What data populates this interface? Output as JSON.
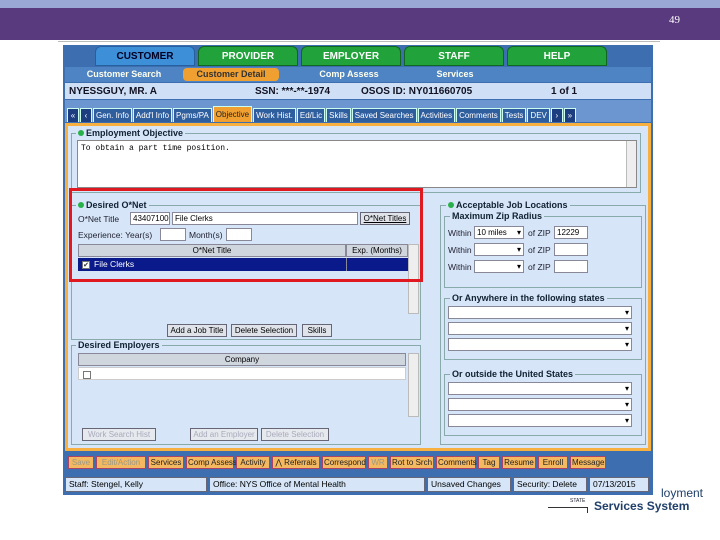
{
  "slide": {
    "page_number": "49"
  },
  "main_tabs": [
    "CUSTOMER",
    "PROVIDER",
    "EMPLOYER",
    "STAFF",
    "HELP"
  ],
  "sub_nav": [
    "Customer Search",
    "Customer Detail",
    "Comp Assess",
    "Services"
  ],
  "customer": {
    "name": "NYESSGUY, MR. A",
    "ssn": "SSN: ***-**-1974",
    "osos_id": "OSOS ID: NY011660705",
    "page": "1 of 1"
  },
  "detail_tabs": [
    "Gen. Info",
    "Add'l Info",
    "Pgms/PA",
    "Objective",
    "Work Hist.",
    "Ed/Lic",
    "Skills",
    "Saved Searches",
    "Activities",
    "Comments",
    "Tests",
    "DEV"
  ],
  "employment_objective": {
    "legend": "Employment Objective",
    "text": "To obtain a part time position."
  },
  "desired_onet": {
    "legend": "Desired O*Net",
    "onet_title_label": "O*Net Title",
    "code": "43407100",
    "title": "File Clerks",
    "onet_titles_button": "O*Net Titles",
    "experience_label": "Experience: Year(s)",
    "months_label": "Month(s)",
    "col_title": "O*Net Title",
    "col_exp": "Exp. (Months)",
    "row_title": "File Clerks",
    "row_checked": "✔"
  },
  "job_buttons": [
    "Add a Job Title",
    "Delete Selection",
    "Skills"
  ],
  "desired_employers": {
    "legend": "Desired Employers",
    "col_company": "Company",
    "buttons": [
      "Work Search Hist",
      "Add an Employer",
      "Delete Selection"
    ]
  },
  "acceptable": {
    "legend": "Acceptable Job Locations",
    "radius_legend": "Maximum Zip Radius",
    "within": "Within",
    "of_zip": "of ZIP",
    "miles": "10 miles",
    "zip": "12229",
    "anywhere_legend": "Or Anywhere in the following states",
    "outside_legend": "Or outside the United States"
  },
  "bottom_buttons": [
    "Save",
    "Edit/Action",
    "Services",
    "Comp Assess",
    "Activity",
    "Referrals",
    "Correspond",
    "WR",
    "Rot to Srch",
    "Comments",
    "Tag",
    "Resume",
    "Enroll",
    "Message"
  ],
  "status": {
    "staff": "Staff: Stengel, Kelly",
    "office": "Office: NYS Office of Mental Health",
    "unsaved": "Unsaved Changes",
    "security": "Security: Delete",
    "date": "07/13/2015"
  },
  "logo": {
    "line1": "loyment",
    "line2_state": "STATE",
    "line2": "Services System"
  },
  "colors": {
    "accent": "#5a3a7e",
    "highlight": "#e01820"
  }
}
